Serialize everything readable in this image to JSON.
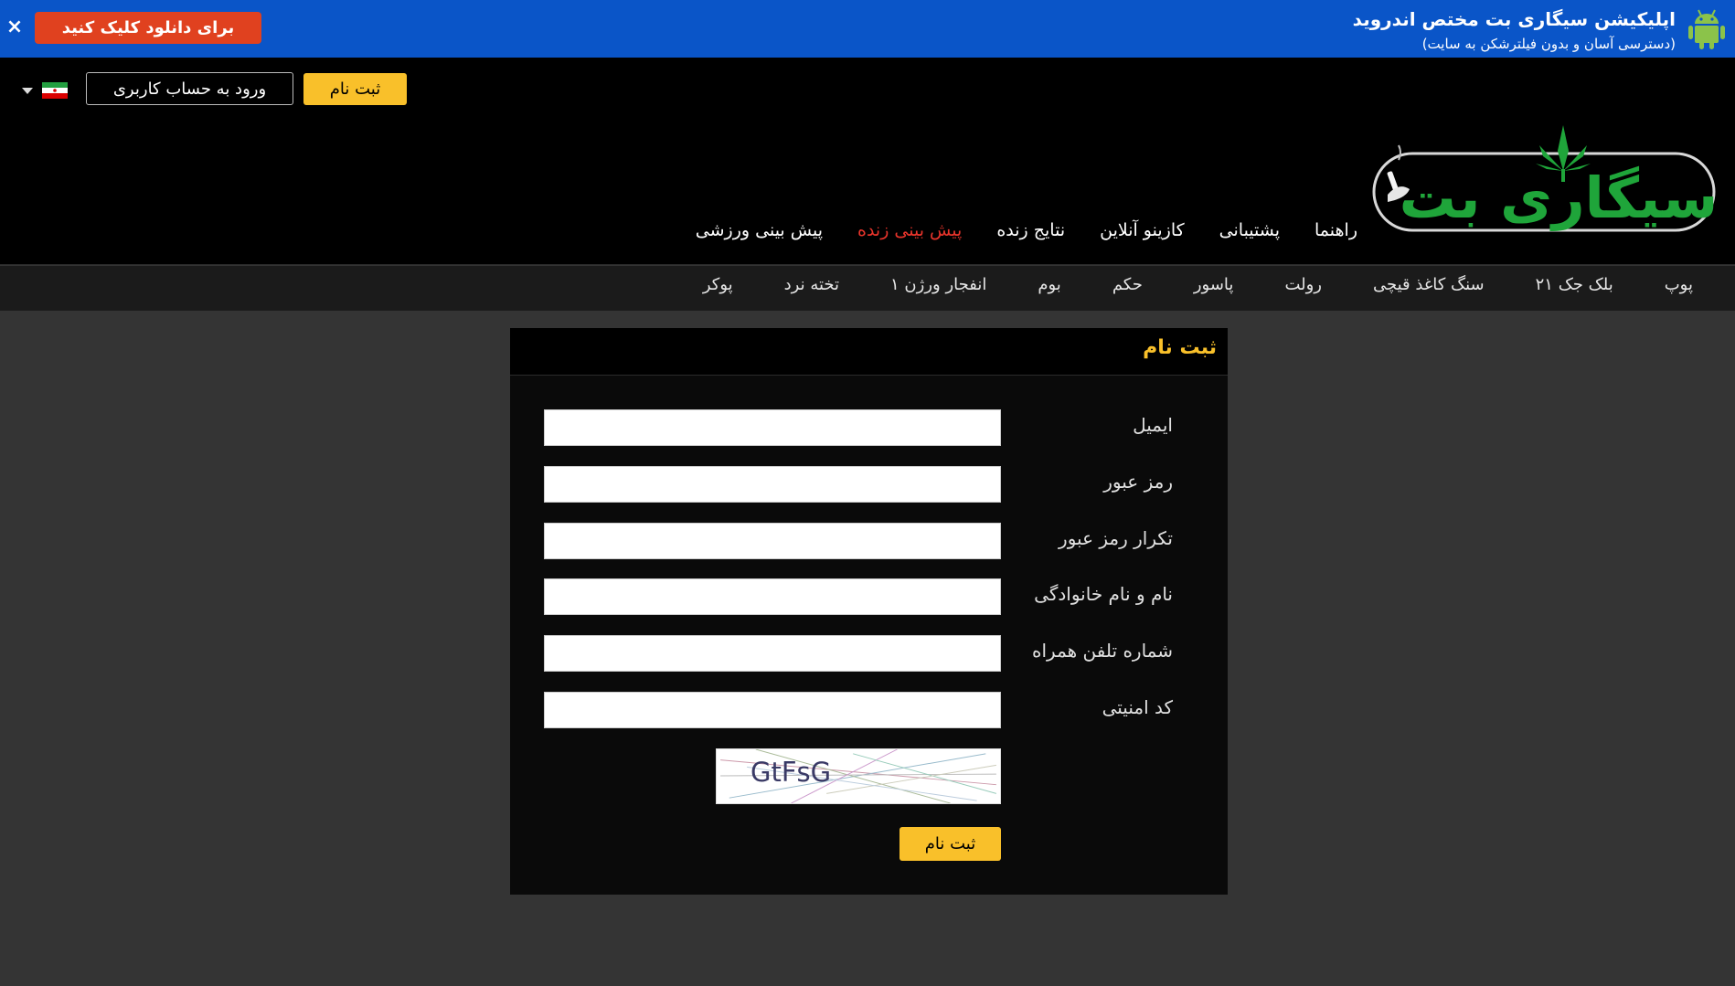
{
  "banner": {
    "title": "اپلیکیشن سیگاری بت مختص اندروید",
    "subtitle": "(دسترسی آسان و بدون فیلترشکن به سایت)",
    "download_label": "برای دانلود کلیک کنید",
    "close_label": "×"
  },
  "header": {
    "signup_label": "ثبت نام",
    "login_label": "ورود به حساب کاربری",
    "logo_text": "سیگاری بت",
    "nav": [
      {
        "label": "پیش بینی ورزشی"
      },
      {
        "label": "پیش بینی زنده"
      },
      {
        "label": "نتایج زنده"
      },
      {
        "label": "کازینو آنلاین"
      },
      {
        "label": "پشتیبانی"
      },
      {
        "label": "راهنما"
      }
    ],
    "active_nav_color": "#e8342b"
  },
  "sub_nav": [
    {
      "label": "پوکر"
    },
    {
      "label": "تخته نرد"
    },
    {
      "label": "انفجار ورژن ۱"
    },
    {
      "label": "بوم"
    },
    {
      "label": "حکم"
    },
    {
      "label": "پاسور"
    },
    {
      "label": "رولت"
    },
    {
      "label": "سنگ کاغذ قیچی"
    },
    {
      "label": "بلک جک ۲۱"
    },
    {
      "label": "پوپ"
    }
  ],
  "form": {
    "title": "ثبت نام",
    "fields": [
      {
        "label": "ایمیل",
        "value": ""
      },
      {
        "label": "رمز عبور",
        "value": ""
      },
      {
        "label": "تکرار رمز عبور",
        "value": ""
      },
      {
        "label": "نام و نام خانوادگی",
        "value": ""
      },
      {
        "label": "شماره تلفن همراه",
        "value": ""
      },
      {
        "label": "کد امنیتی",
        "value": ""
      }
    ],
    "captcha_text": "GtFsG",
    "submit_label": "ثبت نام"
  },
  "colors": {
    "banner_bg": "#0a55c8",
    "accent_yellow": "#f9c02a",
    "download_red": "#e0411f",
    "logo_green": "#1fa53a"
  }
}
